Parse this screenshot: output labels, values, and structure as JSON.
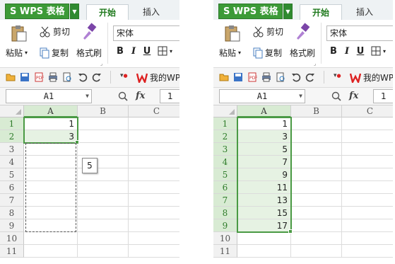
{
  "left": {
    "app_title": "WPS 表格",
    "tabs": [
      "开始",
      "插入"
    ],
    "ribbon": {
      "paste": "粘贴",
      "cut": "剪切",
      "copy": "复制",
      "format_painter": "格式刷",
      "font": "宋体",
      "bold": "B",
      "italic": "I",
      "underline": "U"
    },
    "my_wps": "我的WPS",
    "name_box": "A1",
    "fx": "fx",
    "formula_value": "1",
    "columns": [
      "A",
      "B",
      "C"
    ],
    "rows": [
      "1",
      "2",
      "3",
      "4",
      "5",
      "6",
      "7",
      "8",
      "9",
      "10",
      "11"
    ],
    "col_a_values": [
      "1",
      "3",
      "",
      "",
      "",
      "",
      "",
      "",
      "",
      "",
      ""
    ],
    "fill_tooltip": "5"
  },
  "right": {
    "app_title": "WPS 表格",
    "tabs": [
      "开始",
      "插入"
    ],
    "ribbon": {
      "paste": "粘贴",
      "cut": "剪切",
      "copy": "复制",
      "format_painter": "格式刷",
      "font": "宋体",
      "bold": "B",
      "italic": "I",
      "underline": "U"
    },
    "my_wps": "我的WPS",
    "name_box": "A1",
    "fx": "fx",
    "formula_value": "1",
    "columns": [
      "A",
      "B",
      "C"
    ],
    "rows": [
      "1",
      "2",
      "3",
      "4",
      "5",
      "6",
      "7",
      "8",
      "9",
      "10",
      "11"
    ],
    "col_a_values": [
      "1",
      "3",
      "5",
      "7",
      "9",
      "11",
      "13",
      "15",
      "17",
      "",
      ""
    ]
  },
  "colors": {
    "accent_green": "#3c9a37",
    "selection_fill": "#e6f2e3",
    "header_selected": "#d8ebd3"
  }
}
